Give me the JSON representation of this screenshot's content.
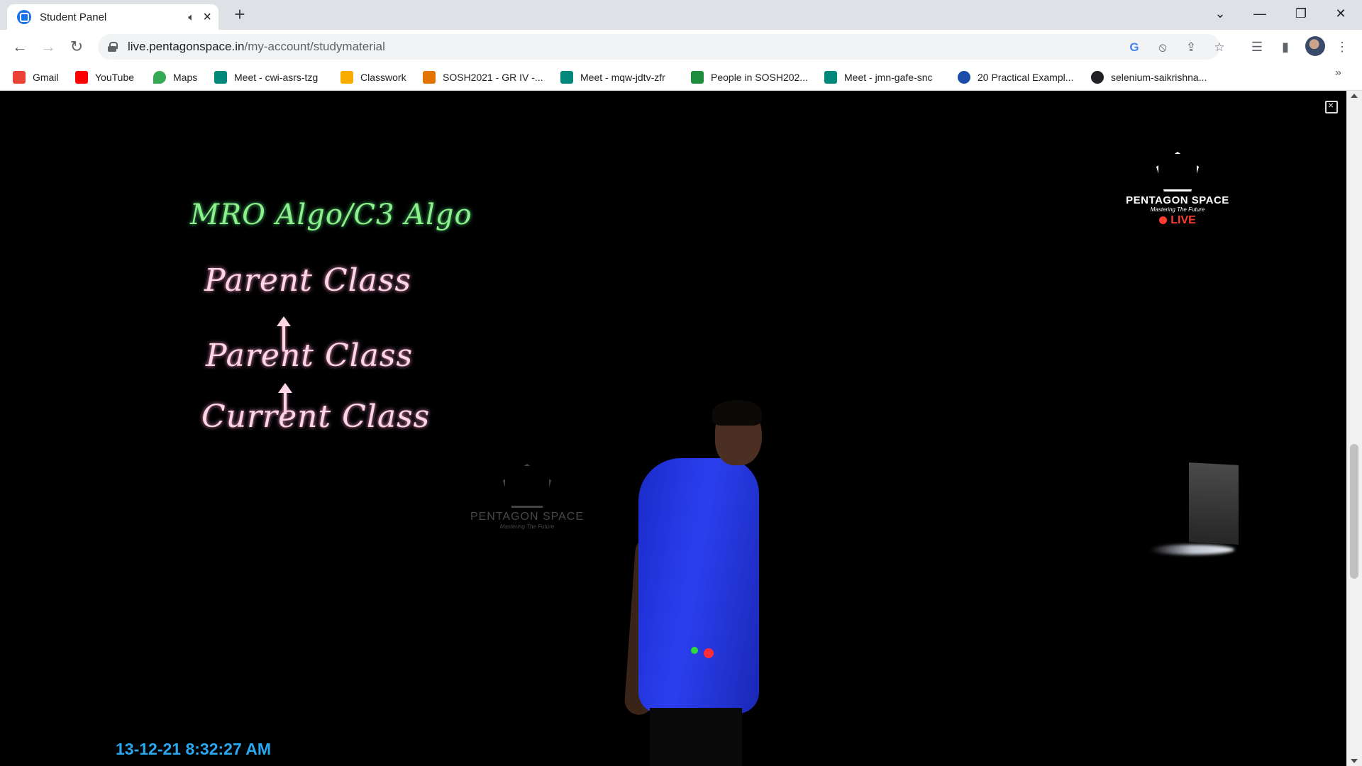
{
  "browser": {
    "tab": {
      "title": "Student Panel",
      "audio_icon": "speaker-icon",
      "close": "×"
    },
    "new_tab": "+",
    "window_controls": {
      "dropdown": "⌄",
      "minimize": "—",
      "restore": "❐",
      "close": "✕"
    },
    "nav": {
      "back": "←",
      "forward": "→",
      "reload": "↻"
    },
    "url": {
      "host": "live.pentagonspace.in",
      "path": "/my-account/studymaterial"
    },
    "omnibox_icons": [
      "google-icon",
      "tracking-blocked-icon",
      "share-icon",
      "bookmark-star-icon"
    ],
    "toolbar_icons": [
      "reading-list-icon",
      "side-panel-icon",
      "profile-avatar",
      "menu-icon"
    ],
    "more_bookmarks": "»"
  },
  "bookmarks": [
    {
      "label": "Gmail",
      "icon": "gmail-icon",
      "color": "#ea4335"
    },
    {
      "label": "YouTube",
      "icon": "youtube-icon",
      "color": "#ff0000"
    },
    {
      "label": "Maps",
      "icon": "maps-icon",
      "color": "#34a853"
    },
    {
      "label": "Meet - cwi-asrs-tzg",
      "icon": "meet-icon",
      "color": "#00897b"
    },
    {
      "label": "Classwork",
      "icon": "classroom-icon",
      "color": "#f9ab00"
    },
    {
      "label": "SOSH2021 - GR IV -...",
      "icon": "classroom-icon",
      "color": "#e37400"
    },
    {
      "label": "Meet - mqw-jdtv-zfr",
      "icon": "meet-icon",
      "color": "#00897b"
    },
    {
      "label": "People in SOSH202...",
      "icon": "classroom-icon",
      "color": "#1e8e3e"
    },
    {
      "label": "Meet - jmn-gafe-snc",
      "icon": "meet-icon",
      "color": "#00897b"
    },
    {
      "label": "20 Practical Exampl...",
      "icon": "site-icon",
      "color": "#1a4da8"
    },
    {
      "label": "selenium-saikrishna...",
      "icon": "github-icon",
      "color": "#202124"
    }
  ],
  "video": {
    "board": {
      "title": "MRO Algo/C3 Algo",
      "lines": [
        "Parent Class",
        "Parent Class",
        "Current Class"
      ]
    },
    "logo": {
      "name": "PENTAGON SPACE",
      "tagline": "Mastering The Future",
      "live": "LIVE"
    },
    "watermark": {
      "name": "PENTAGON SPACE",
      "tagline": "Mastering The Future"
    },
    "timestamp": "13-12-21 8:32:27 AM"
  }
}
